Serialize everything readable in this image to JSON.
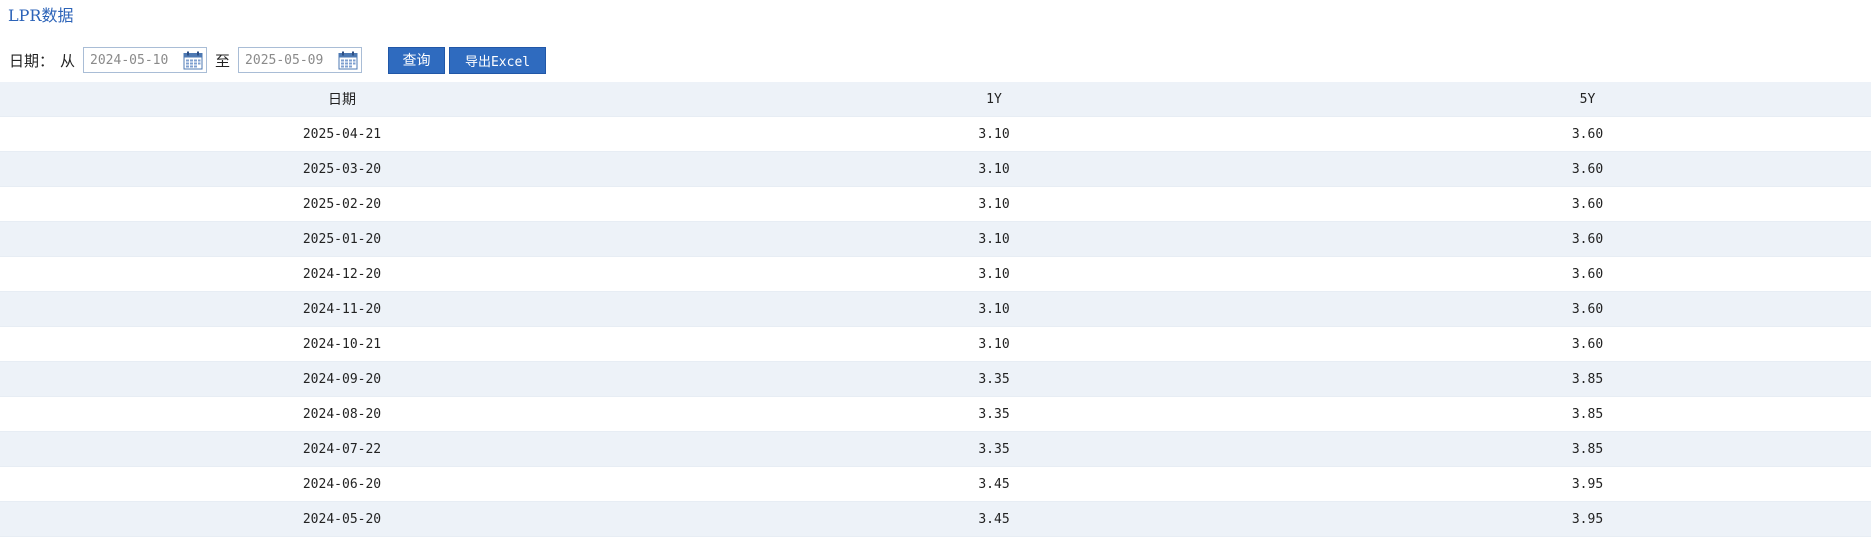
{
  "page": {
    "title": "LPR数据"
  },
  "filters": {
    "date_label": "日期：",
    "from_label": "从",
    "to_label": "至",
    "start_date": "2024-05-10",
    "end_date": "2025-05-09",
    "query_label": "查询",
    "export_label": "导出Excel",
    "icon_calendar": "calendar-icon"
  },
  "table": {
    "columns": [
      "日期",
      "1Y",
      "5Y"
    ],
    "rows": [
      [
        "2025-04-21",
        "3.10",
        "3.60"
      ],
      [
        "2025-03-20",
        "3.10",
        "3.60"
      ],
      [
        "2025-02-20",
        "3.10",
        "3.60"
      ],
      [
        "2025-01-20",
        "3.10",
        "3.60"
      ],
      [
        "2024-12-20",
        "3.10",
        "3.60"
      ],
      [
        "2024-11-20",
        "3.10",
        "3.60"
      ],
      [
        "2024-10-21",
        "3.10",
        "3.60"
      ],
      [
        "2024-09-20",
        "3.35",
        "3.85"
      ],
      [
        "2024-08-20",
        "3.35",
        "3.85"
      ],
      [
        "2024-07-22",
        "3.35",
        "3.85"
      ],
      [
        "2024-06-20",
        "3.45",
        "3.95"
      ],
      [
        "2024-05-20",
        "3.45",
        "3.95"
      ]
    ]
  },
  "colors": {
    "accent": "#2f6bbf",
    "title": "#2c63b8",
    "stripe": "#edf2f8",
    "border": "#a9bdd6"
  }
}
